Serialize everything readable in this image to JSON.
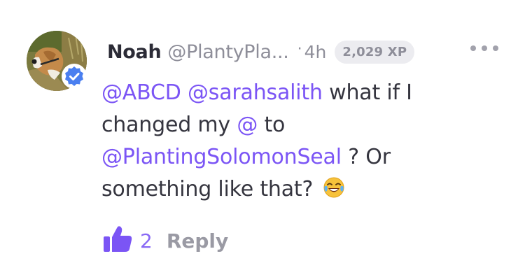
{
  "comment": {
    "author": {
      "name": "Noah",
      "handle": "@PlantyPla...",
      "verified_icon": "verified-check-icon",
      "avatar": "dog-photo-avatar"
    },
    "meta": {
      "separator": "·",
      "time": "4h",
      "xp": "2,029 XP"
    },
    "more_icon": "more-horizontal-icon",
    "text": {
      "mention_1": "@ABCD",
      "mention_2": "@sarahsalith",
      "part_1": " what if I changed my ",
      "mention_3": "@",
      "part_2": " to ",
      "mention_4": "@PlantingSolomonSeal",
      "part_3": " ? Or something like that? ",
      "emoji": "laughing-tears-emoji"
    },
    "actions": {
      "like_icon": "thumbs-up-icon",
      "like_count": "2",
      "reply_label": "Reply"
    },
    "colors": {
      "accent": "#7b55f5",
      "verified": "#4a7ff0",
      "muted": "#8e8e99"
    }
  }
}
